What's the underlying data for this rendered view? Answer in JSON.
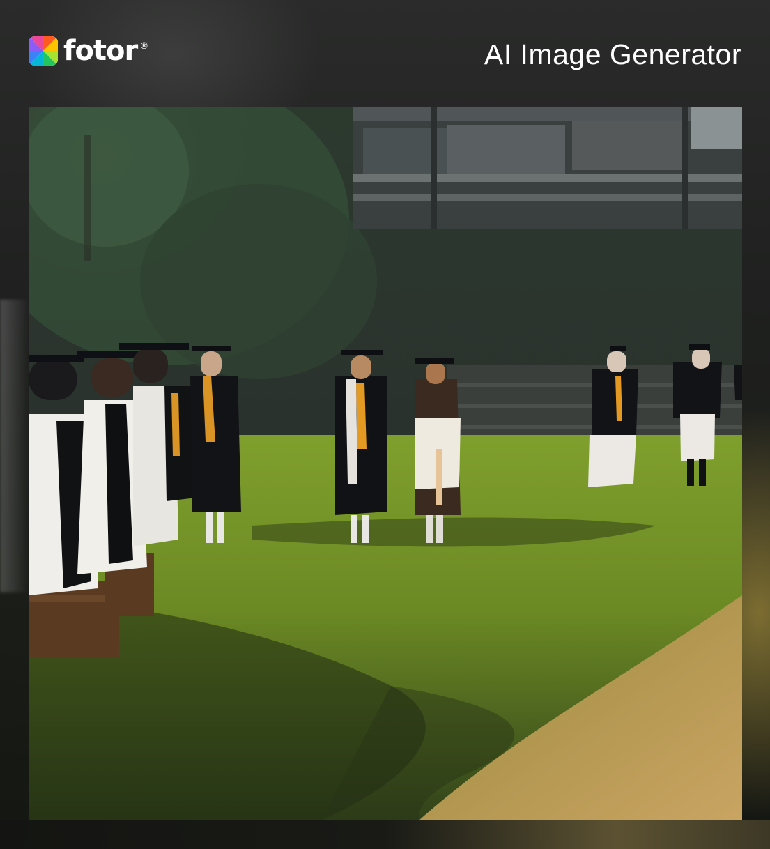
{
  "brand": {
    "name": "fotor",
    "registered_mark": "®",
    "logo_icon": "color-wheel-icon"
  },
  "header": {
    "title": "AI Image Generator"
  },
  "image": {
    "subject": "graduation-ceremony-scene"
  },
  "colors": {
    "background": "#1b1d1a",
    "text": "#ffffff",
    "grass": "#7e9a2a",
    "path": "#c9a55c"
  }
}
